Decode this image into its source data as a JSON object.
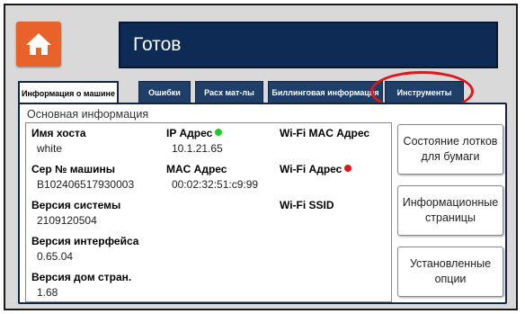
{
  "header": {
    "status": "Готов",
    "home_icon": "home-icon",
    "home_color": "#e8622a",
    "bar_color": "#0d2b55"
  },
  "tabs": [
    {
      "label": "Информация о машине",
      "active": true
    },
    {
      "label": "Ошибки",
      "active": false
    },
    {
      "label": "Расх мат-лы",
      "active": false
    },
    {
      "label": "Биллинговая информация",
      "active": false
    },
    {
      "label": "Инструменты",
      "active": false,
      "highlighted": true
    }
  ],
  "section": {
    "title": "Основная информация"
  },
  "fields": {
    "hostname": {
      "label": "Имя хоста",
      "value": "white"
    },
    "serial": {
      "label": "Сер № машины",
      "value": "B102406517930003"
    },
    "system_version": {
      "label": "Версия системы",
      "value": "2109120504"
    },
    "ui_version": {
      "label": "Версия интерфейса",
      "value": "0.65.04"
    },
    "home_version": {
      "label": "Версия дом стран.",
      "value": "1.68"
    },
    "ip": {
      "label": "IP Адрес",
      "value": "10.1.21.65",
      "status_color": "#22cc22"
    },
    "mac": {
      "label": "MAC Адрес",
      "value": "00:02:32:51:c9:99"
    },
    "wifi_mac": {
      "label": "Wi-Fi MAC Адрес"
    },
    "wifi_ip": {
      "label": "Wi-Fi Адрес",
      "status_color": "#e0161b"
    },
    "wifi_ssid": {
      "label": "Wi-Fi SSID"
    }
  },
  "side_buttons": {
    "tray_status": "Состояние лотков для бумаги",
    "info_pages": "Информационные страницы",
    "installed_options": "Установленные опции"
  },
  "annotation_color": "#e0161b"
}
